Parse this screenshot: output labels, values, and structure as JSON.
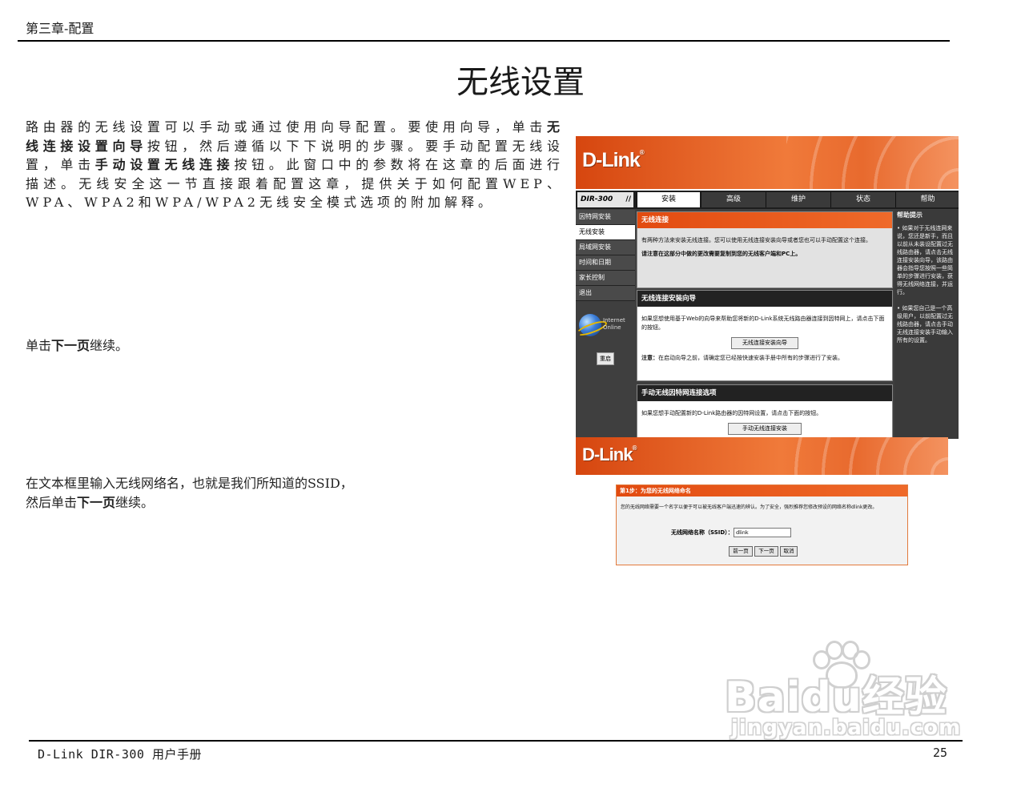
{
  "header": {
    "chapter": "第三章-配置"
  },
  "title": "无线设置",
  "intro": {
    "t1": "路由器的无线设置可以手动或通过使用向导配置。要使用向导，单击",
    "b1": "无线连接设置向导",
    "t2": "按钮，然后遵循以下下说明的步骤。要手动配置无线设置，单击",
    "b2": "手动设置无线连接",
    "t3": "按钮。此窗口中的参数将在这章的后面进行描述。无线安全这一节直接跟着配置这章，提供关于如何配置WEP、WPA、WPA2和WPA/WPA2无线安全模式选项的附加解释。"
  },
  "step1": {
    "t1": "单击",
    "b1": "下一页",
    "t2": "继续。"
  },
  "step2": {
    "line1": "在文本框里输入无线网络名，也就是我们所知道的SSID，",
    "t1": "然后单击",
    "b1": "下一页",
    "t2": "继续。"
  },
  "footer": {
    "left": "D-Link DIR-300 用户手册",
    "page": "25"
  },
  "router": {
    "logo": "D-Link",
    "logo_mark": "®",
    "model": "DIR-300",
    "model_bars": "//",
    "tabs": [
      "安装",
      "高级",
      "维护",
      "状态",
      "帮助"
    ],
    "side_menu": [
      "因特网安装",
      "无线安装",
      "局域网安装",
      "时间和日期",
      "家长控制",
      "退出"
    ],
    "globe_label": "Internet Online",
    "reboot": "重启",
    "panel1": {
      "title": "无线连接",
      "desc": "有两种方法来安装无线连接。您可以使用无线连接安装向导或者您也可以手动配置这个连接。",
      "note": "请注意在这部分中做的更改需要复制到您的无线客户端和PC上。"
    },
    "panel2": {
      "title": "无线连接安装向导",
      "desc": "如果您想使用基于Web的向导来帮助您将新的D-Link系统无线路由器连接到因特网上，请点击下面的按钮。",
      "button": "无线连接安装向导",
      "note_label": "注意：",
      "note": "在启动向导之前，请确定您已经按快速安装手册中所有的步骤进行了安装。"
    },
    "panel3": {
      "title": "手动无线因特网连接选项",
      "desc": "如果您想手动配置新的D-Link路由器的因特网设置，请点击下面的按钮。",
      "button": "手动无线连接安装"
    },
    "help": {
      "title": "帮助提示",
      "p1": "• 如果对于无线连网来说，您还是新手，而且以前从未装设配置过无线路由器，请点击无线连接安装向导，该路由器会指导您按照一些简单的步骤进行安装，获得无线网络连接，并运行。",
      "p2": "• 如果您自己是一个高级用户，以前配置过无线路由器，请点击手动无线连接安装手动输入所有的设置。"
    }
  },
  "ssid_panel": {
    "header": "第1步：为您的无线网络命名",
    "desc": "您的无线网络需要一个名字以便于可以被无线客户端迅速的辨认。为了安全，强烈推荐您修改预设的网络名称dlink更改。",
    "label": "无线网络名称（SSID）：",
    "value": "dlink",
    "buttons": [
      "前一页",
      "下一页",
      "取消"
    ]
  },
  "watermark": {
    "main": "Baidu经验",
    "sub": "jingyan.baidu.com"
  }
}
